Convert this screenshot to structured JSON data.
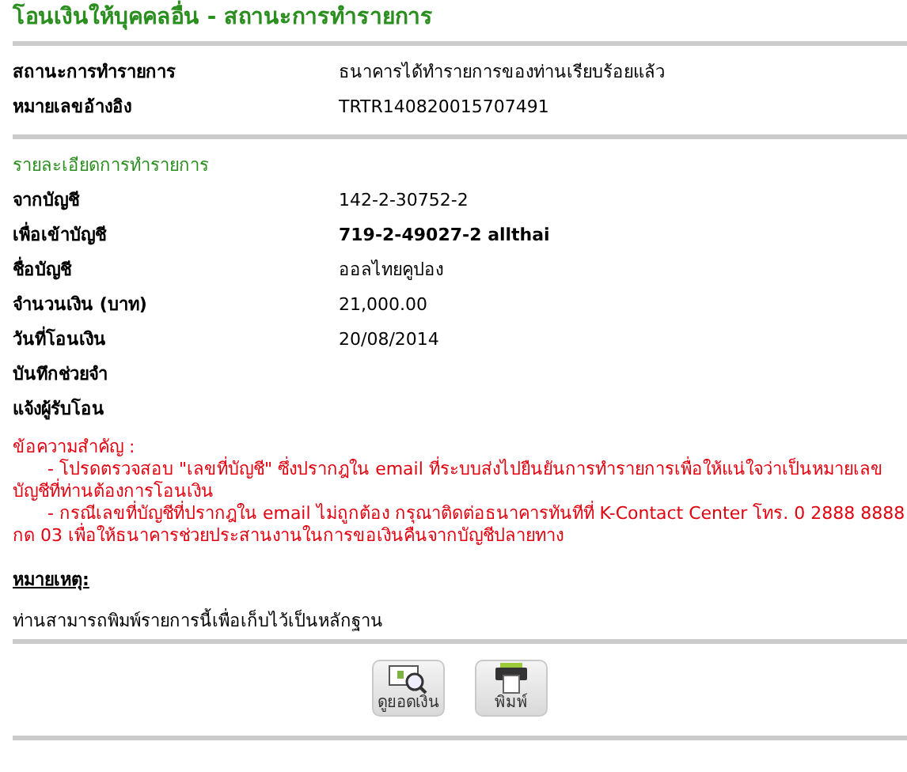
{
  "title": "โอนเงินให้บุคคลอื่น - สถานะการทำรายการ",
  "status_rows": [
    {
      "label": "สถานะการทำรายการ",
      "value": "ธนาคารได้ทำรายการของท่านเรียบร้อยแล้ว",
      "emphasis": false
    },
    {
      "label": "หมายเลขอ้างอิง",
      "value": "TRTR140820015707491",
      "emphasis": false
    }
  ],
  "details_heading": "รายละเอียดการทำรายการ",
  "detail_rows": [
    {
      "label": "จากบัญชี",
      "value": "142-2-30752-2",
      "emphasis": false
    },
    {
      "label": "เพื่อเข้าบัญชี",
      "value": "719-2-49027-2 allthai",
      "emphasis": true
    },
    {
      "label": "ชื่อบัญชี",
      "value": "ออลไทยคูปอง",
      "emphasis": false
    },
    {
      "label": "จำนวนเงิน (บาท)",
      "value": "21,000.00",
      "emphasis": false
    },
    {
      "label": "วันที่โอนเงิน",
      "value": "20/08/2014",
      "emphasis": false
    },
    {
      "label": "บันทึกช่วยจำ"
    },
    {
      "label": "แจ้งผู้รับโอน"
    }
  ],
  "warning": {
    "heading": "ข้อความสำคัญ :",
    "items": [
      "- โปรดตรวจสอบ \"เลขที่บัญชี\" ซึ่งปรากฎใน email ที่ระบบส่งไปยืนยันการทำรายการเพื่อให้แน่ใจว่าเป็นหมายเลขบัญชีที่ท่านต้องการโอนเงิน",
      "- กรณีเลขที่บัญชีที่ปรากฎใน email ไม่ถูกต้อง กรุณาติดต่อธนาคารทันทีที่ K-Contact Center โทร. 0 2888 8888 กด 03 เพื่อให้ธนาคารช่วยประสานงานในการขอเงินคืนจากบัญชีปลายทาง"
    ]
  },
  "note": {
    "heading": "หมายเหตุ:",
    "text": "ท่านสามารถพิมพ์รายการนี้เพื่อเก็บไว้เป็นหลักฐาน"
  },
  "buttons": [
    {
      "kind": "balance",
      "label": "ดูยอดเงิน"
    },
    {
      "kind": "print",
      "label": "พิมพ์"
    }
  ]
}
